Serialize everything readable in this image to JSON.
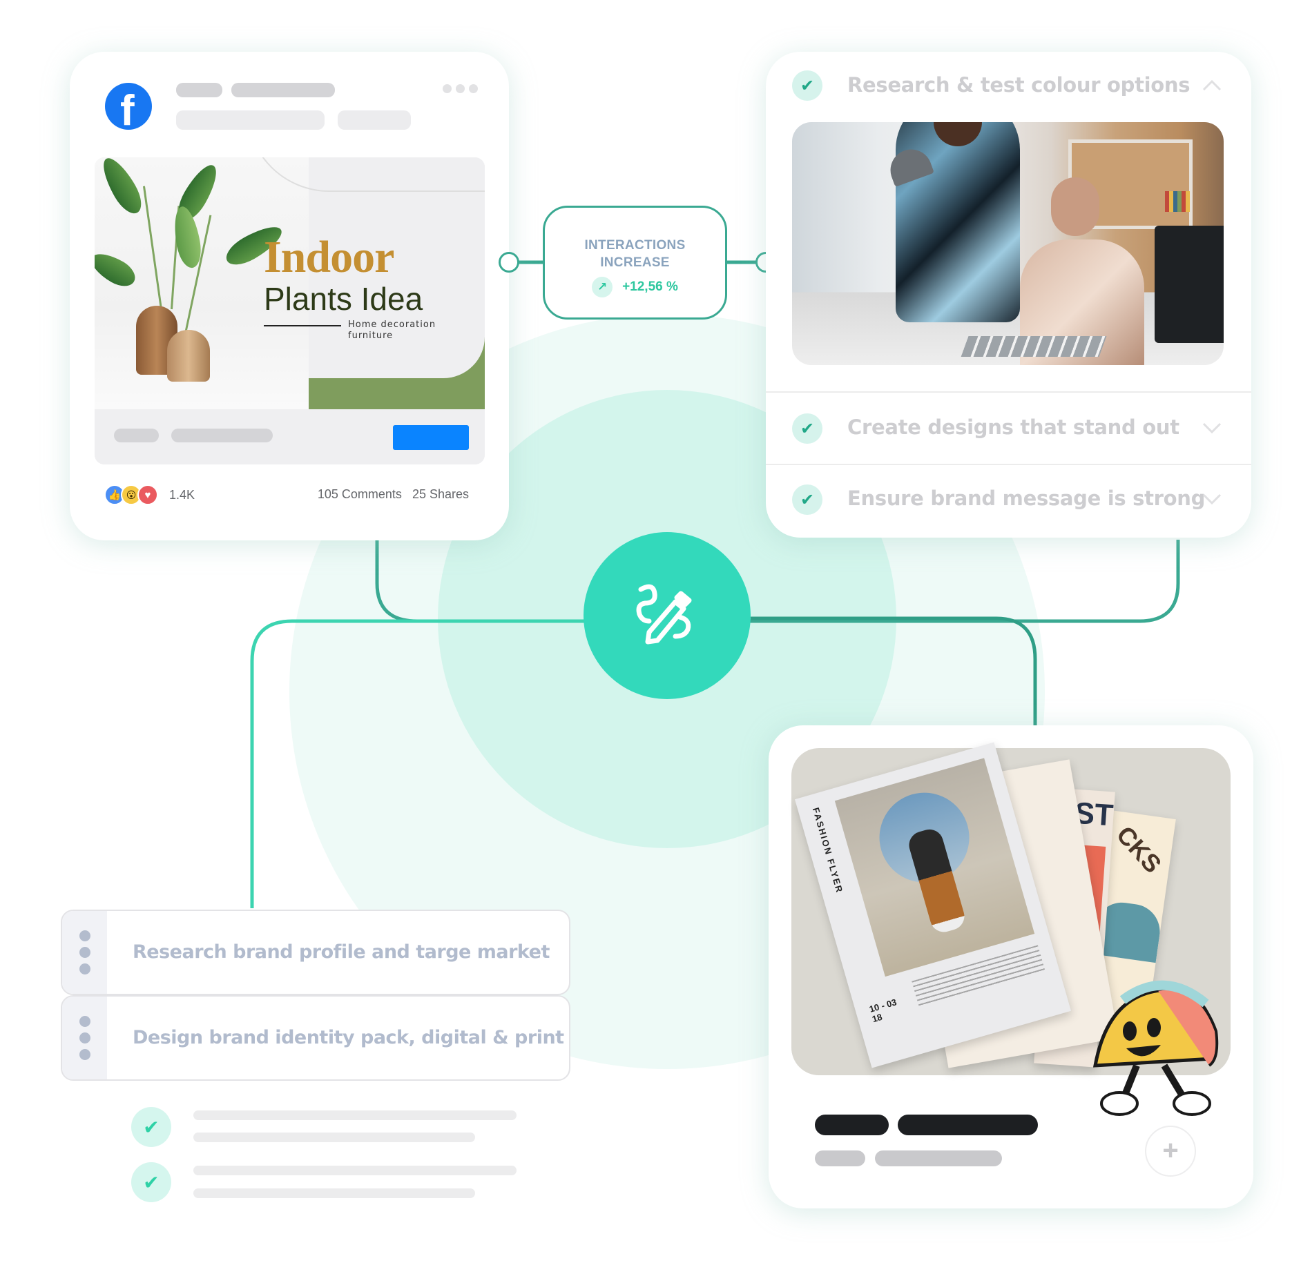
{
  "diagram": {
    "accent_color": "#33d9bb",
    "line_color": "#3aa992",
    "center_icon": "pen-with-squiggle-icon"
  },
  "facebook_post": {
    "logo_icon": "facebook-logo-icon",
    "more_icon": "more-dots-icon",
    "ad": {
      "title_line1": "Indoor",
      "title_line2": "Plants Idea",
      "subtitle_line1": "Home decoration",
      "subtitle_line2": "furniture"
    },
    "reactions": {
      "icons": [
        "like-icon",
        "wow-icon",
        "love-icon"
      ],
      "like_glyph": "👍",
      "wow_glyph": "😮",
      "love_glyph": "♥",
      "count": "1.4K"
    },
    "comments": "105 Comments",
    "shares": "25 Shares"
  },
  "metric": {
    "title_line1": "INTERACTIONS",
    "title_line2": "INCREASE",
    "arrow_glyph": "↗",
    "value": "+12,56 %"
  },
  "accordion": {
    "items": [
      {
        "label": "Research & test colour options",
        "expanded": true,
        "checked": true
      },
      {
        "label": "Create designs that stand out",
        "expanded": false,
        "checked": true
      },
      {
        "label": "Ensure brand message is strong",
        "expanded": false,
        "checked": true
      }
    ],
    "check_glyph": "✔"
  },
  "tasks": [
    {
      "label": "Research brand profile and targe market"
    },
    {
      "label": "Design brand identity pack, digital & print"
    }
  ],
  "checklist": {
    "check_glyph": "✔",
    "items": 2
  },
  "flyers": {
    "main_title": "FASHION FLYER",
    "dates": "10 - 03\n18",
    "poster_text": "EST",
    "poster2_text": "CKS",
    "plus_glyph": "+"
  }
}
